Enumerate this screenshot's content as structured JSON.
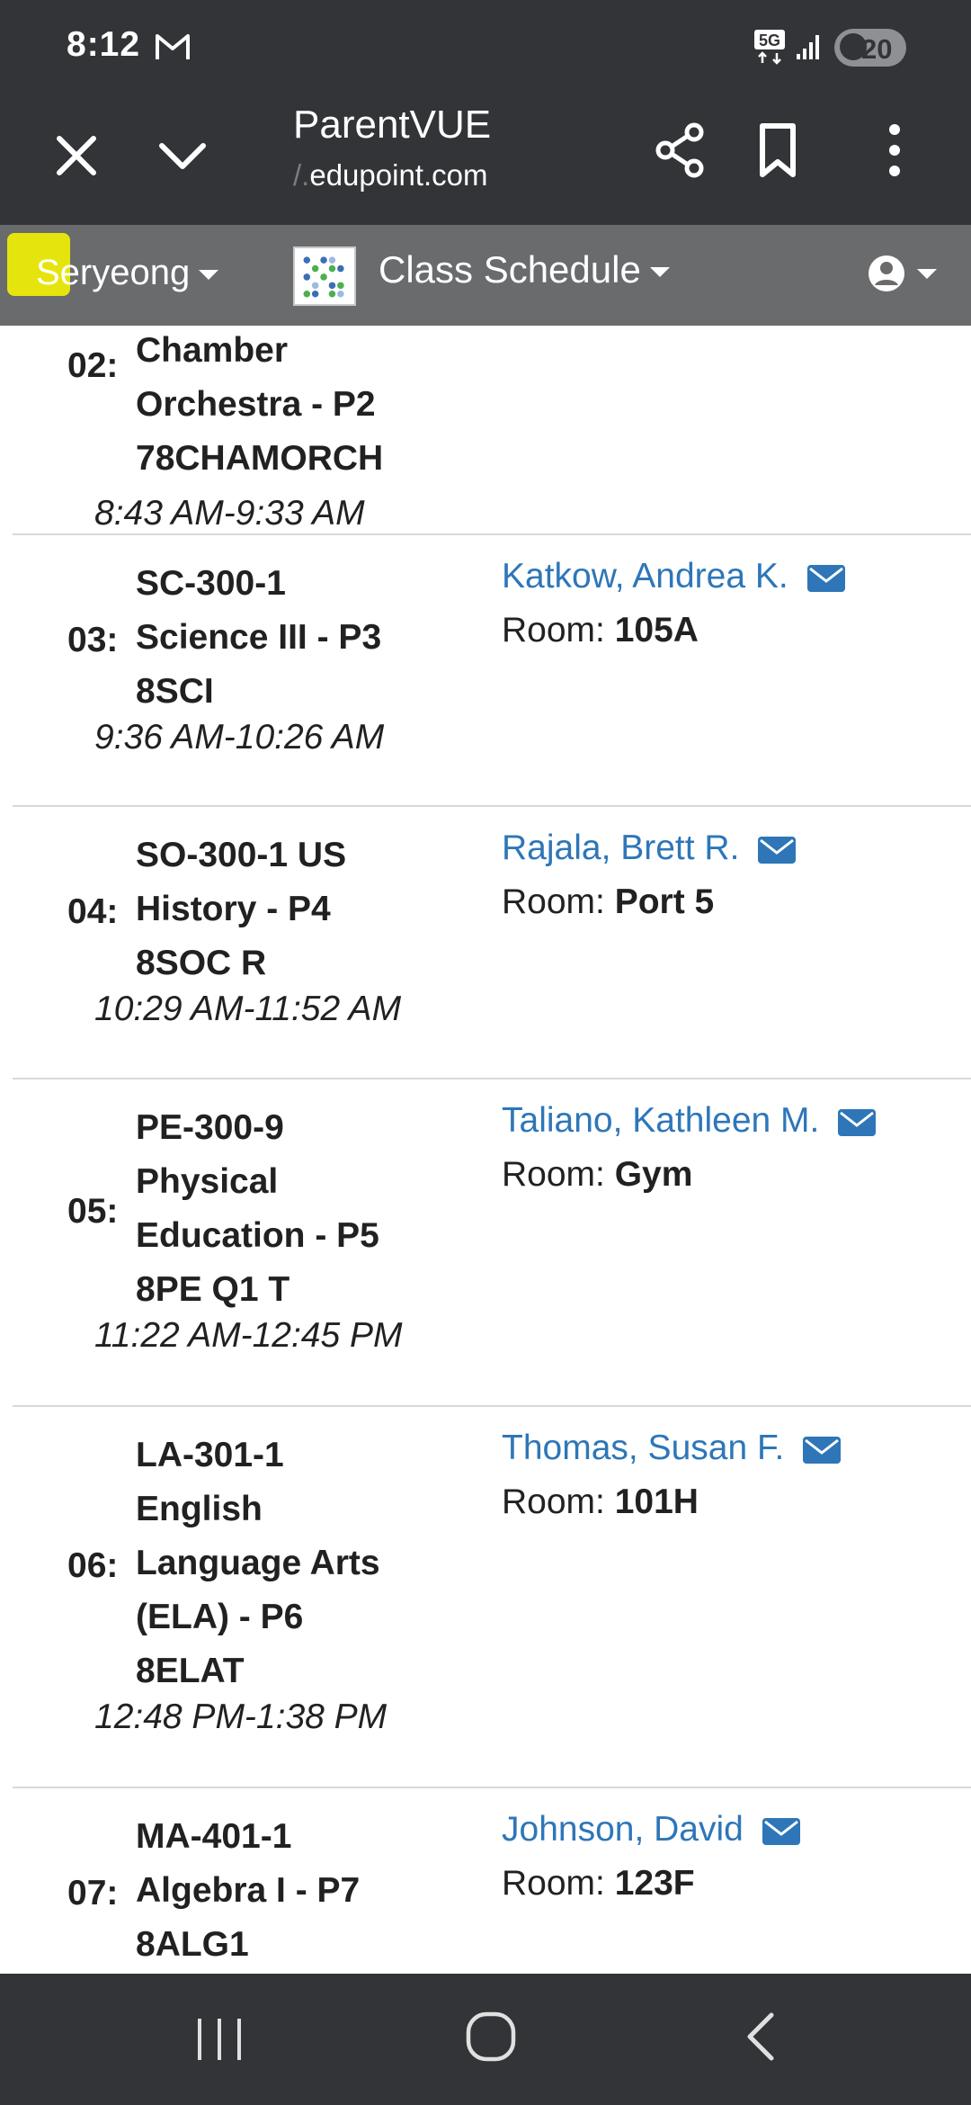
{
  "status_bar": {
    "time": "8:12",
    "network": "5G",
    "battery": "20"
  },
  "browser": {
    "title": "ParentVUE",
    "url_faded": "/.",
    "url": "edupoint.com"
  },
  "toolbar": {
    "student": "Seryeong",
    "page": "Class Schedule",
    "highlight_color": "#e5e50d"
  },
  "schedule": {
    "rows": [
      {
        "period": "02:",
        "course_lines": [
          "Chamber",
          "Orchestra - P2",
          "78CHAMORCH"
        ],
        "time": "8:43 AM-9:33 AM",
        "teacher": "",
        "room_label": "",
        "room": ""
      },
      {
        "period": "03:",
        "course_lines": [
          "SC-300-1",
          "Science III - P3",
          "8SCI"
        ],
        "time": "9:36 AM-10:26 AM",
        "teacher": "Katkow, Andrea K.",
        "room_label": "Room:",
        "room": "105A"
      },
      {
        "period": "04:",
        "course_lines": [
          "SO-300-1 US",
          "History - P4",
          "8SOC R"
        ],
        "time": "10:29 AM-11:52 AM",
        "teacher": "Rajala, Brett R.",
        "room_label": "Room:",
        "room": "Port 5"
      },
      {
        "period": "05:",
        "course_lines": [
          "PE-300-9",
          "Physical",
          "Education - P5",
          "8PE Q1 T"
        ],
        "time": "11:22 AM-12:45 PM",
        "teacher": "Taliano, Kathleen M.",
        "room_label": "Room:",
        "room": "Gym"
      },
      {
        "period": "06:",
        "course_lines": [
          "LA-301-1",
          "English",
          "Language Arts",
          "(ELA) - P6",
          "8ELAT"
        ],
        "time": "12:48 PM-1:38 PM",
        "teacher": "Thomas, Susan F.",
        "room_label": "Room:",
        "room": "101H"
      },
      {
        "period": "07:",
        "course_lines": [
          "MA-401-1",
          "Algebra I - P7",
          "8ALG1"
        ],
        "time": "",
        "teacher": "Johnson, David",
        "room_label": "Room:",
        "room": "123F"
      }
    ]
  },
  "colors": {
    "link": "#2e76b8",
    "bar_dark": "#323437",
    "toolbar_gray": "#6a6b6d"
  }
}
